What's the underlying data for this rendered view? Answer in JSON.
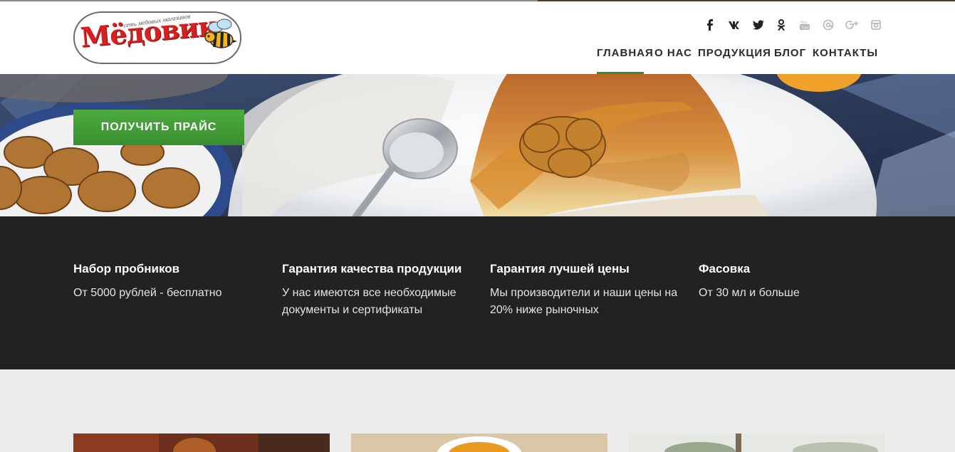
{
  "brand": {
    "logo_word": "Мёдовик",
    "logo_tagline": "сеть медовых магазинов"
  },
  "social": [
    "facebook-icon",
    "vk-icon",
    "twitter-icon",
    "odnoklassniki-icon",
    "youtube-icon",
    "mail-icon",
    "google-plus-icon",
    "instagram-icon"
  ],
  "nav": {
    "home": "ГЛАВНАЯ",
    "about": "О НАС",
    "products": "ПРОДУКЦИЯ",
    "blog": "БЛОГ",
    "contacts": "КОНТАКТЫ",
    "active": "home"
  },
  "hero": {
    "cta_label": "ПОЛУЧИТЬ ПРАЙС"
  },
  "features": [
    {
      "title": "Набор пробников",
      "text": "От 5000 рублей - бесплатно"
    },
    {
      "title": "Гарантия качества продукции",
      "text": "У нас имеются все необходимые документы и сертификаты"
    },
    {
      "title": "Гарантия лучшей цены",
      "text": "Мы производители и наши цены на 20% ниже рыночных"
    },
    {
      "title": "Фасовка",
      "text": "От 30 мл и больше"
    }
  ],
  "colors": {
    "accent_green": "#3a8a2e",
    "brand_red": "#d81f1f",
    "dark_band": "#222222"
  }
}
